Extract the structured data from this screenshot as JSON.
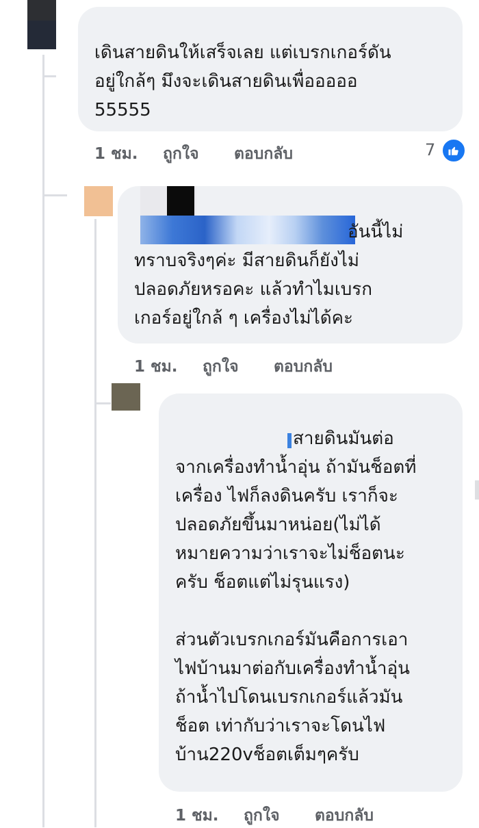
{
  "comments": [
    {
      "text": "เดินสายดินให้เสร็จเลย แต่เบรกเกอร์ดัน\nอยู่ใกล้ๆ มึงจะเดินสายดินเพื่อออออ\n55555",
      "time": "1 ชม.",
      "like": "ถูกใจ",
      "reply": "ตอบกลับ",
      "reaction_count": "7",
      "reaction_icon": "thumbs-up-icon"
    },
    {
      "text": "อันนี้ไม่\nทราบจริงๆค่ะ มีสายดินก็ยังไม่\nปลอดภัยหรอคะ แล้วทำไมเบรก\nเกอร์อยู่ใกล้ ๆ เครื่องไม่ได้คะ",
      "time": "1 ชม.",
      "like": "ถูกใจ",
      "reply": "ตอบกลับ"
    },
    {
      "text": "สายดินมันต่อ\nจากเครื่องทำน้ำอุ่น ถ้ามันช็อตที่\nเครื่อง ไฟก็ลงดินครับ เราก็จะ\nปลอดภัยขึ้นมาหน่อย(ไม่ได้\nหมายความว่าเราจะไม่ช็อตนะ\nครับ ช็อตแต่ไม่รุนแรง)\n\nส่วนตัวเบรกเกอร์มันคือการเอา\nไฟบ้านมาต่อกับเครื่องทำน้ำอุ่น\nถ้าน้ำไปโดนเบรกเกอร์แล้วมัน\nช็อต เท่ากับว่าเราจะโดนไฟ\nบ้าน220vช็อตเต็มๆครับ",
      "time": "1 ชม.",
      "like": "ถูกใจ",
      "reply": "ตอบกลับ"
    }
  ],
  "colors": {
    "bubble": "#eff1f4",
    "meta_text": "#5e6166",
    "like_blue": "#1877f2",
    "thread_line": "#dcdee3"
  }
}
